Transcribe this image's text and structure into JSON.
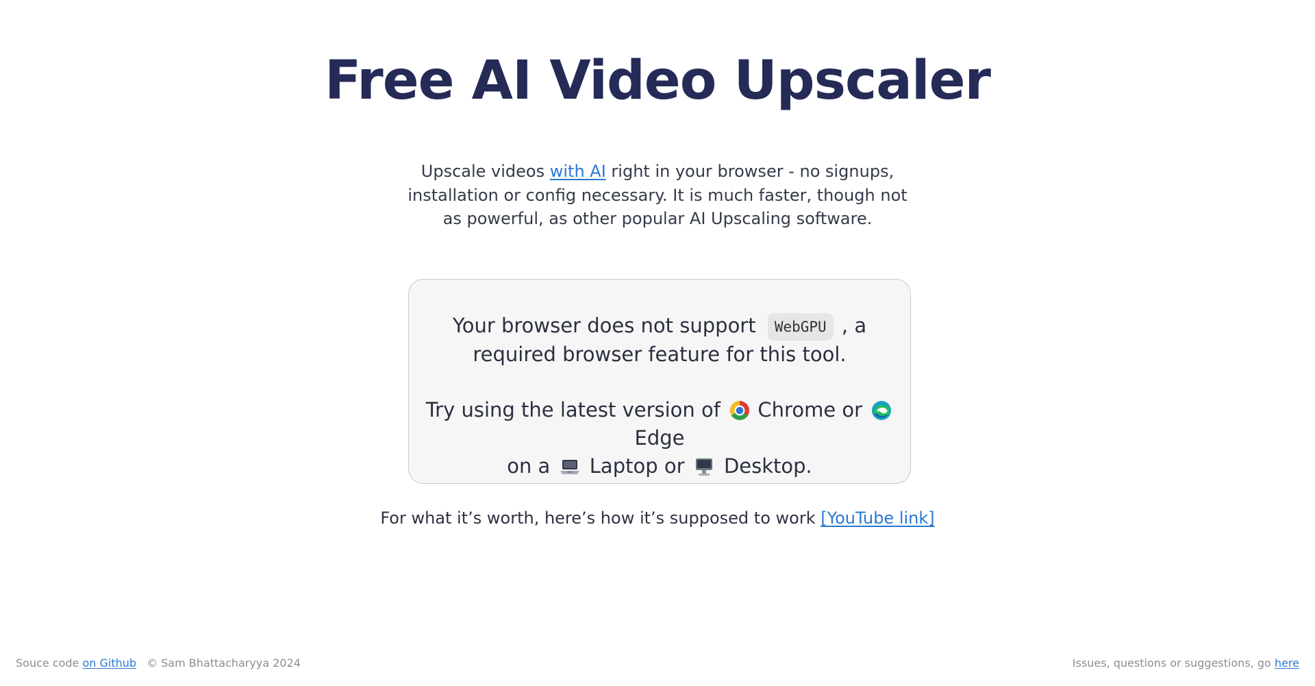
{
  "title": "Free AI Video Upscaler",
  "intro": {
    "before_link": "Upscale videos ",
    "link_label": "with AI",
    "after_link": " right in your browser - no signups, installation or config necessary. It is much faster, though not as powerful, as other popular AI Upscaling software."
  },
  "notice": {
    "line1_before": "Your browser does not support ",
    "code_label": "WebGPU",
    "line1_after": " , a required browser feature for this tool.",
    "line2_part1": "Try using the latest version of ",
    "chrome_label": " Chrome",
    "or_text": " or ",
    "edge_label": " Edge",
    "line2_part2": " on a ",
    "laptop_label": " Laptop",
    "or_text_2": " or ",
    "desktop_label": " Desktop."
  },
  "youtube_note": {
    "text": "For what it’s worth, here’s how it’s supposed to work ",
    "link_label": "[YouTube link]"
  },
  "footer": {
    "source_text": "Souce code ",
    "source_link": "on Github",
    "copyright": "© Sam Bhattacharyya 2024",
    "issues_text": "Issues, questions or suggestions, go ",
    "issues_link": "here"
  },
  "colors": {
    "title": "#252a57",
    "link": "#2a78d2",
    "card_background": "#f6f6f6",
    "card_border": "#c7c9cf",
    "footer_text": "#8b8d97"
  },
  "icons": {
    "chrome": "chrome-logo-icon",
    "edge": "edge-logo-icon",
    "laptop": "laptop-icon",
    "desktop": "desktop-computer-icon"
  }
}
